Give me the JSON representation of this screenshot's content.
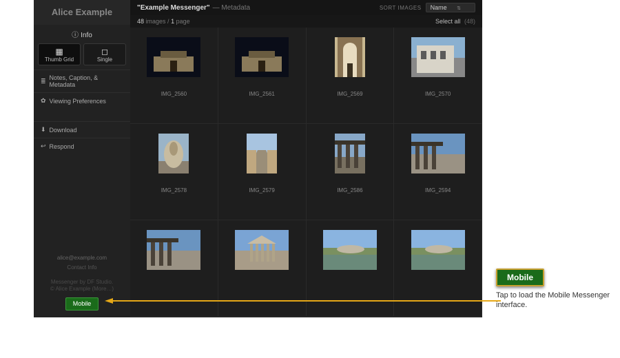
{
  "sidebar": {
    "owner": "Alice Example",
    "info": "Info",
    "view_thumb": "Thumb Grid",
    "view_single": "Single",
    "items": {
      "notes": "Notes, Caption, & Metadata",
      "prefs": "Viewing Preferences",
      "download": "Download",
      "respond": "Respond"
    },
    "email": "alice@example.com",
    "contact": "Contact Info",
    "credit_line1": "Messenger by DF Studio.",
    "credit_line2": "© Alice Example (More…)",
    "mobile_btn": "Mobile"
  },
  "header": {
    "title": "\"Example Messenger\"",
    "subtitle": "— Metadata",
    "sort_label": "SORT IMAGES",
    "sort_value": "Name"
  },
  "countbar": {
    "count": "48",
    "count_suffix": "images /",
    "page_num": "1",
    "page_suffix": "page",
    "select_all": "Select all",
    "select_all_count": "(48)"
  },
  "thumbs": [
    {
      "name": "IMG_2560",
      "orient": "land"
    },
    {
      "name": "IMG_2561",
      "orient": "land"
    },
    {
      "name": "IMG_2569",
      "orient": "port"
    },
    {
      "name": "IMG_2570",
      "orient": "land"
    },
    {
      "name": "IMG_2578",
      "orient": "port"
    },
    {
      "name": "IMG_2579",
      "orient": "port"
    },
    {
      "name": "IMG_2586",
      "orient": "port"
    },
    {
      "name": "IMG_2594",
      "orient": "land"
    },
    {
      "name": "",
      "orient": "land"
    },
    {
      "name": "",
      "orient": "land"
    },
    {
      "name": "",
      "orient": "land"
    },
    {
      "name": "",
      "orient": "land"
    }
  ],
  "annotation": {
    "button": "Mobile",
    "text": "Tap to load the Mobile Messenger interface."
  }
}
